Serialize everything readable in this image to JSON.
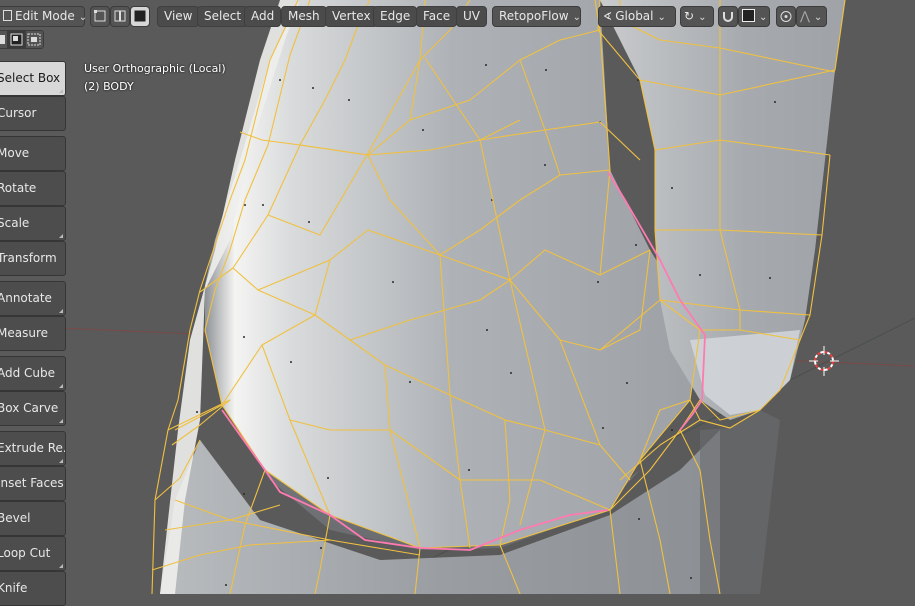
{
  "header": {
    "mode": "Edit Mode",
    "menus": [
      "View",
      "Select",
      "Add",
      "Mesh",
      "Vertex",
      "Edge",
      "Face",
      "UV"
    ],
    "addon": "RetopoFlow",
    "orientation": "Global"
  },
  "toolbar": {
    "tools": [
      "Select Box",
      "Cursor",
      "Move",
      "Rotate",
      "Scale",
      "Transform",
      "Annotate",
      "Measure",
      "Add Cube",
      "Box Carve",
      "Extrude Re...",
      "Inset Faces",
      "Bevel",
      "Loop Cut",
      "Knife"
    ],
    "active_tool": "Select Box"
  },
  "viewport": {
    "view_name": "User Orthographic (Local)",
    "object_name": "(2) BODY",
    "colors": {
      "background": "#5a5a5a",
      "wire": "#f0c040",
      "seam": "#ff7ab0",
      "axis_line": "#7a4a48",
      "surface_light": "#e6e8ea",
      "surface_dark": "#8a8e92"
    },
    "icons": [
      "3d-cursor-icon"
    ]
  }
}
